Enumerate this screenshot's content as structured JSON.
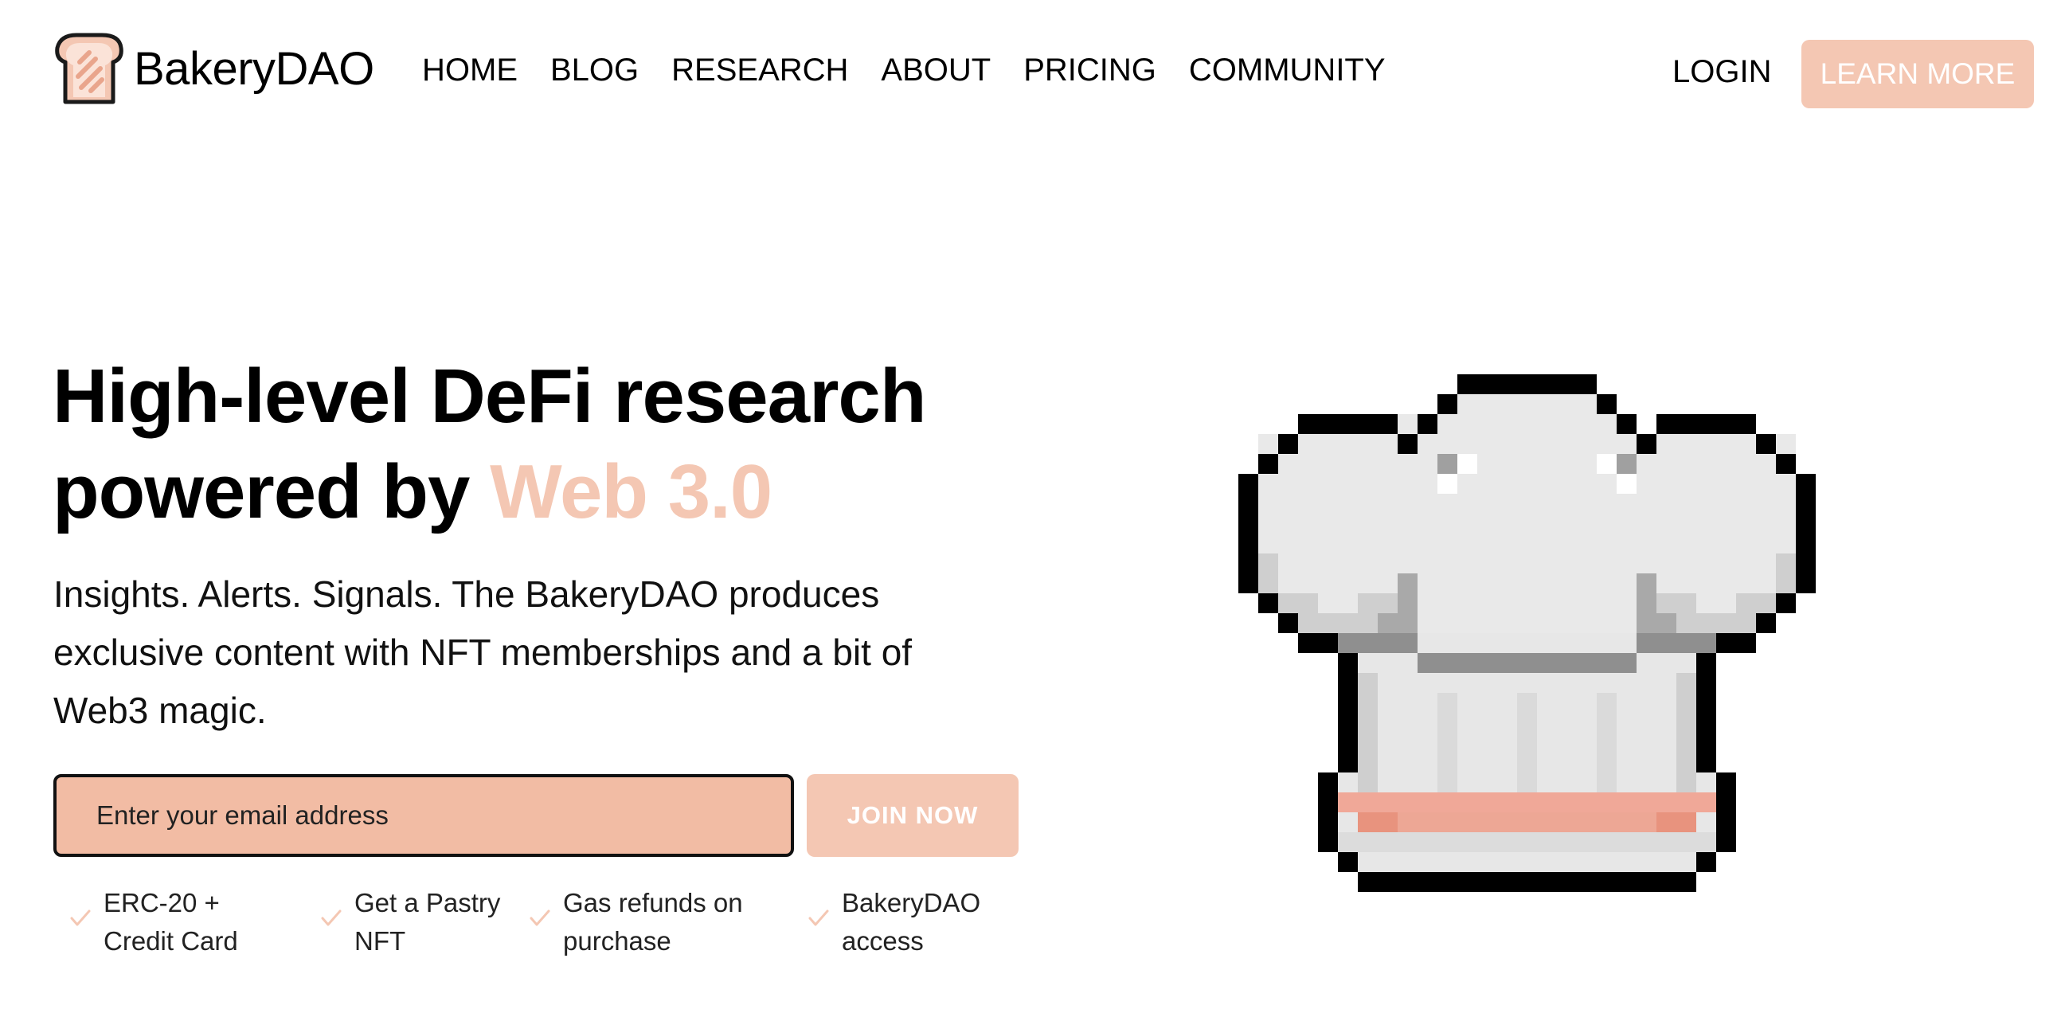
{
  "brand": {
    "name": "BakeryDAO",
    "logo_icon": "toast-icon"
  },
  "nav": {
    "items": [
      "HOME",
      "BLOG",
      "RESEARCH",
      "ABOUT",
      "PRICING",
      "COMMUNITY"
    ],
    "login_label": "LOGIN",
    "learn_more_label": "LEARN MORE"
  },
  "hero": {
    "headline_line1": "High-level DeFi research",
    "headline_line2_prefix": "powered by ",
    "headline_accent": "Web 3.0",
    "subtitle": "Insights. Alerts. Signals. The BakeryDAO produces exclusive content with NFT memberships and a bit of Web3 magic.",
    "email_placeholder": "Enter your email address",
    "join_label": "JOIN NOW",
    "features": [
      {
        "line1": "ERC-20 +",
        "line2": "Credit Card",
        "icon": "check-icon"
      },
      {
        "line1": "Get a Pastry",
        "line2": "NFT",
        "icon": "check-icon"
      },
      {
        "line1": "Gas refunds on",
        "line2": "purchase",
        "icon": "check-icon"
      },
      {
        "line1": "BakeryDAO",
        "line2": "access",
        "icon": "check-icon"
      }
    ],
    "illustration": "chef-hat-pixel-art"
  },
  "colors": {
    "accent": "#f4c7b3",
    "input_fill": "#f2bca4",
    "text": "#000000",
    "hat_band": "#eda795"
  }
}
